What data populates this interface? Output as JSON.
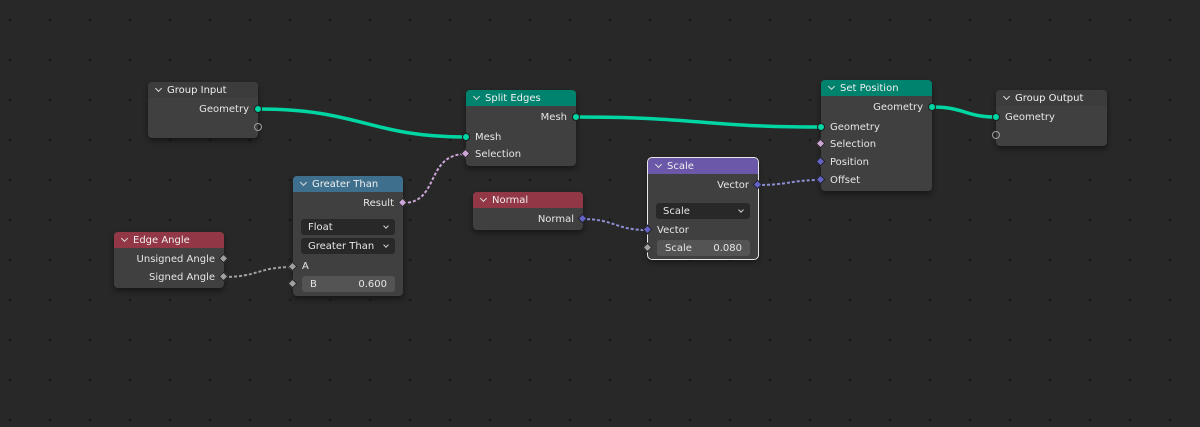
{
  "colors": {
    "background": "#282828",
    "node_body": "#404040",
    "header_input": "#3c3c3c",
    "header_geometry": "#00836e",
    "header_function": "#3e6f8c",
    "header_attribute": "#923746",
    "header_vector": "#6b58a8",
    "socket_geometry": "#00d6a3",
    "socket_boolean": "#cca6d6",
    "socket_vector": "#6363c7",
    "socket_float": "#a1a1a1"
  },
  "nodes": {
    "group_input": {
      "title": "Group Input",
      "outputs": [
        "Geometry"
      ]
    },
    "split_edges": {
      "title": "Split Edges",
      "outputs": [
        "Mesh"
      ],
      "inputs": [
        "Mesh",
        "Selection"
      ]
    },
    "set_position": {
      "title": "Set Position",
      "outputs": [
        "Geometry"
      ],
      "inputs": [
        "Geometry",
        "Selection",
        "Position",
        "Offset"
      ]
    },
    "group_output": {
      "title": "Group Output",
      "inputs": [
        "Geometry"
      ]
    },
    "greater_than": {
      "title": "Greater Than",
      "outputs": [
        "Result"
      ],
      "type_dropdown": "Float",
      "mode_dropdown": "Greater Than",
      "input_a": "A",
      "input_b_label": "B",
      "input_b_value": "0.600"
    },
    "edge_angle": {
      "title": "Edge Angle",
      "outputs": [
        "Unsigned Angle",
        "Signed Angle"
      ]
    },
    "normal": {
      "title": "Normal",
      "outputs": [
        "Normal"
      ]
    },
    "scale": {
      "title": "Scale",
      "outputs": [
        "Vector"
      ],
      "mode_dropdown": "Scale",
      "input_vector": "Vector",
      "input_scale_label": "Scale",
      "input_scale_value": "0.080"
    }
  }
}
